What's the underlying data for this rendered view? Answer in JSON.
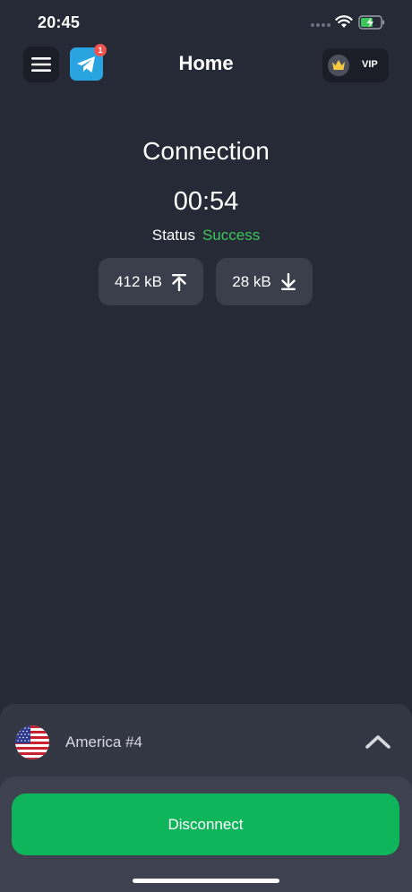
{
  "status_bar": {
    "time": "20:45"
  },
  "header": {
    "title": "Home",
    "menu_icon": "hamburger-menu-icon",
    "telegram_icon": "telegram-icon",
    "telegram_badge": "1",
    "vip_label": "VIP",
    "vip_icon": "crown-icon"
  },
  "connection": {
    "title": "Connection",
    "timer": "00:54",
    "status_label": "Status",
    "status_value": "Success",
    "upload": "412 kB",
    "download": "28 kB"
  },
  "server": {
    "name": "America #4",
    "flag_icon": "us-flag-icon"
  },
  "actions": {
    "disconnect_label": "Disconnect"
  },
  "colors": {
    "background": "#262a37",
    "success": "#3cc55a",
    "disconnect_button": "#0fb55a",
    "telegram": "#29a4e0",
    "badge": "#ef5350"
  }
}
